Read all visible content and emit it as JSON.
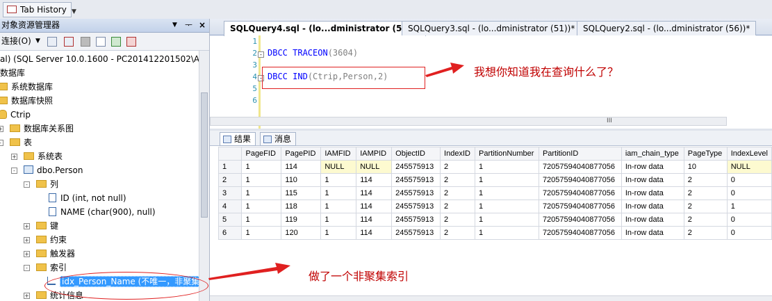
{
  "toolbar": {
    "tab_history": "Tab History"
  },
  "object_explorer": {
    "title": "对象资源管理器",
    "pin": "ᅮ",
    "close": "×",
    "connect_label": "连接(O)",
    "tree": {
      "server": "al) (SQL Server 10.0.1600 - PC201412201502\\Adm",
      "databases": "数据库",
      "system_databases": "系统数据库",
      "database_snapshots": "数据库快照",
      "ctrip": "Ctrip",
      "db_diagrams": "数据库关系图",
      "tables": "表",
      "system_tables": "系统表",
      "dbo_person": "dbo.Person",
      "columns": "列",
      "col_id": "ID (int, not null)",
      "col_name": "NAME (char(900), null)",
      "keys": "键",
      "constraints": "约束",
      "triggers": "触发器",
      "indexes": "索引",
      "index_item": "idx_Person_Name (不唯一，非聚集",
      "statistics": "统计信息"
    }
  },
  "editor": {
    "tabs": [
      {
        "label": "SQLQuery4.sql - (lo...dministrator (57))*"
      },
      {
        "label": "SQLQuery3.sql - (lo...dministrator (51))*"
      },
      {
        "label": "SQLQuery2.sql - (lo...dministrator (56))*"
      }
    ],
    "line_numbers": [
      "1",
      "2",
      "3",
      "4",
      "5",
      "6"
    ],
    "line2": {
      "keyword": "DBCC",
      "rest1": " TRACEON",
      "rest2": "(3604)"
    },
    "line4": {
      "keyword": "DBCC",
      "rest1": " IND",
      "rest2": "(Ctrip,Person,2)"
    },
    "fold_minus": "-",
    "hscroll_grip": "III"
  },
  "results": {
    "tabs": {
      "results": "结果",
      "messages": "消息"
    },
    "columns": [
      "PageFID",
      "PagePID",
      "IAMFID",
      "IAMPID",
      "ObjectID",
      "IndexID",
      "PartitionNumber",
      "PartitionID",
      "iam_chain_type",
      "PageType",
      "IndexLevel"
    ],
    "rows": [
      [
        "1",
        "1",
        "114",
        "NULL",
        "NULL",
        "245575913",
        "2",
        "1",
        "72057594040877056",
        "In-row data",
        "10",
        "NULL"
      ],
      [
        "2",
        "1",
        "110",
        "1",
        "114",
        "245575913",
        "2",
        "1",
        "72057594040877056",
        "In-row data",
        "2",
        "0"
      ],
      [
        "3",
        "1",
        "115",
        "1",
        "114",
        "245575913",
        "2",
        "1",
        "72057594040877056",
        "In-row data",
        "2",
        "0"
      ],
      [
        "4",
        "1",
        "118",
        "1",
        "114",
        "245575913",
        "2",
        "1",
        "72057594040877056",
        "In-row data",
        "2",
        "1"
      ],
      [
        "5",
        "1",
        "119",
        "1",
        "114",
        "245575913",
        "2",
        "1",
        "72057594040877056",
        "In-row data",
        "2",
        "0"
      ],
      [
        "6",
        "1",
        "120",
        "1",
        "114",
        "245575913",
        "2",
        "1",
        "72057594040877056",
        "In-row data",
        "2",
        "0"
      ]
    ]
  },
  "annotations": {
    "question": "我想你知道我在查询什么了？",
    "index_note": "做了一个非聚集索引",
    "color": "#e02020"
  }
}
